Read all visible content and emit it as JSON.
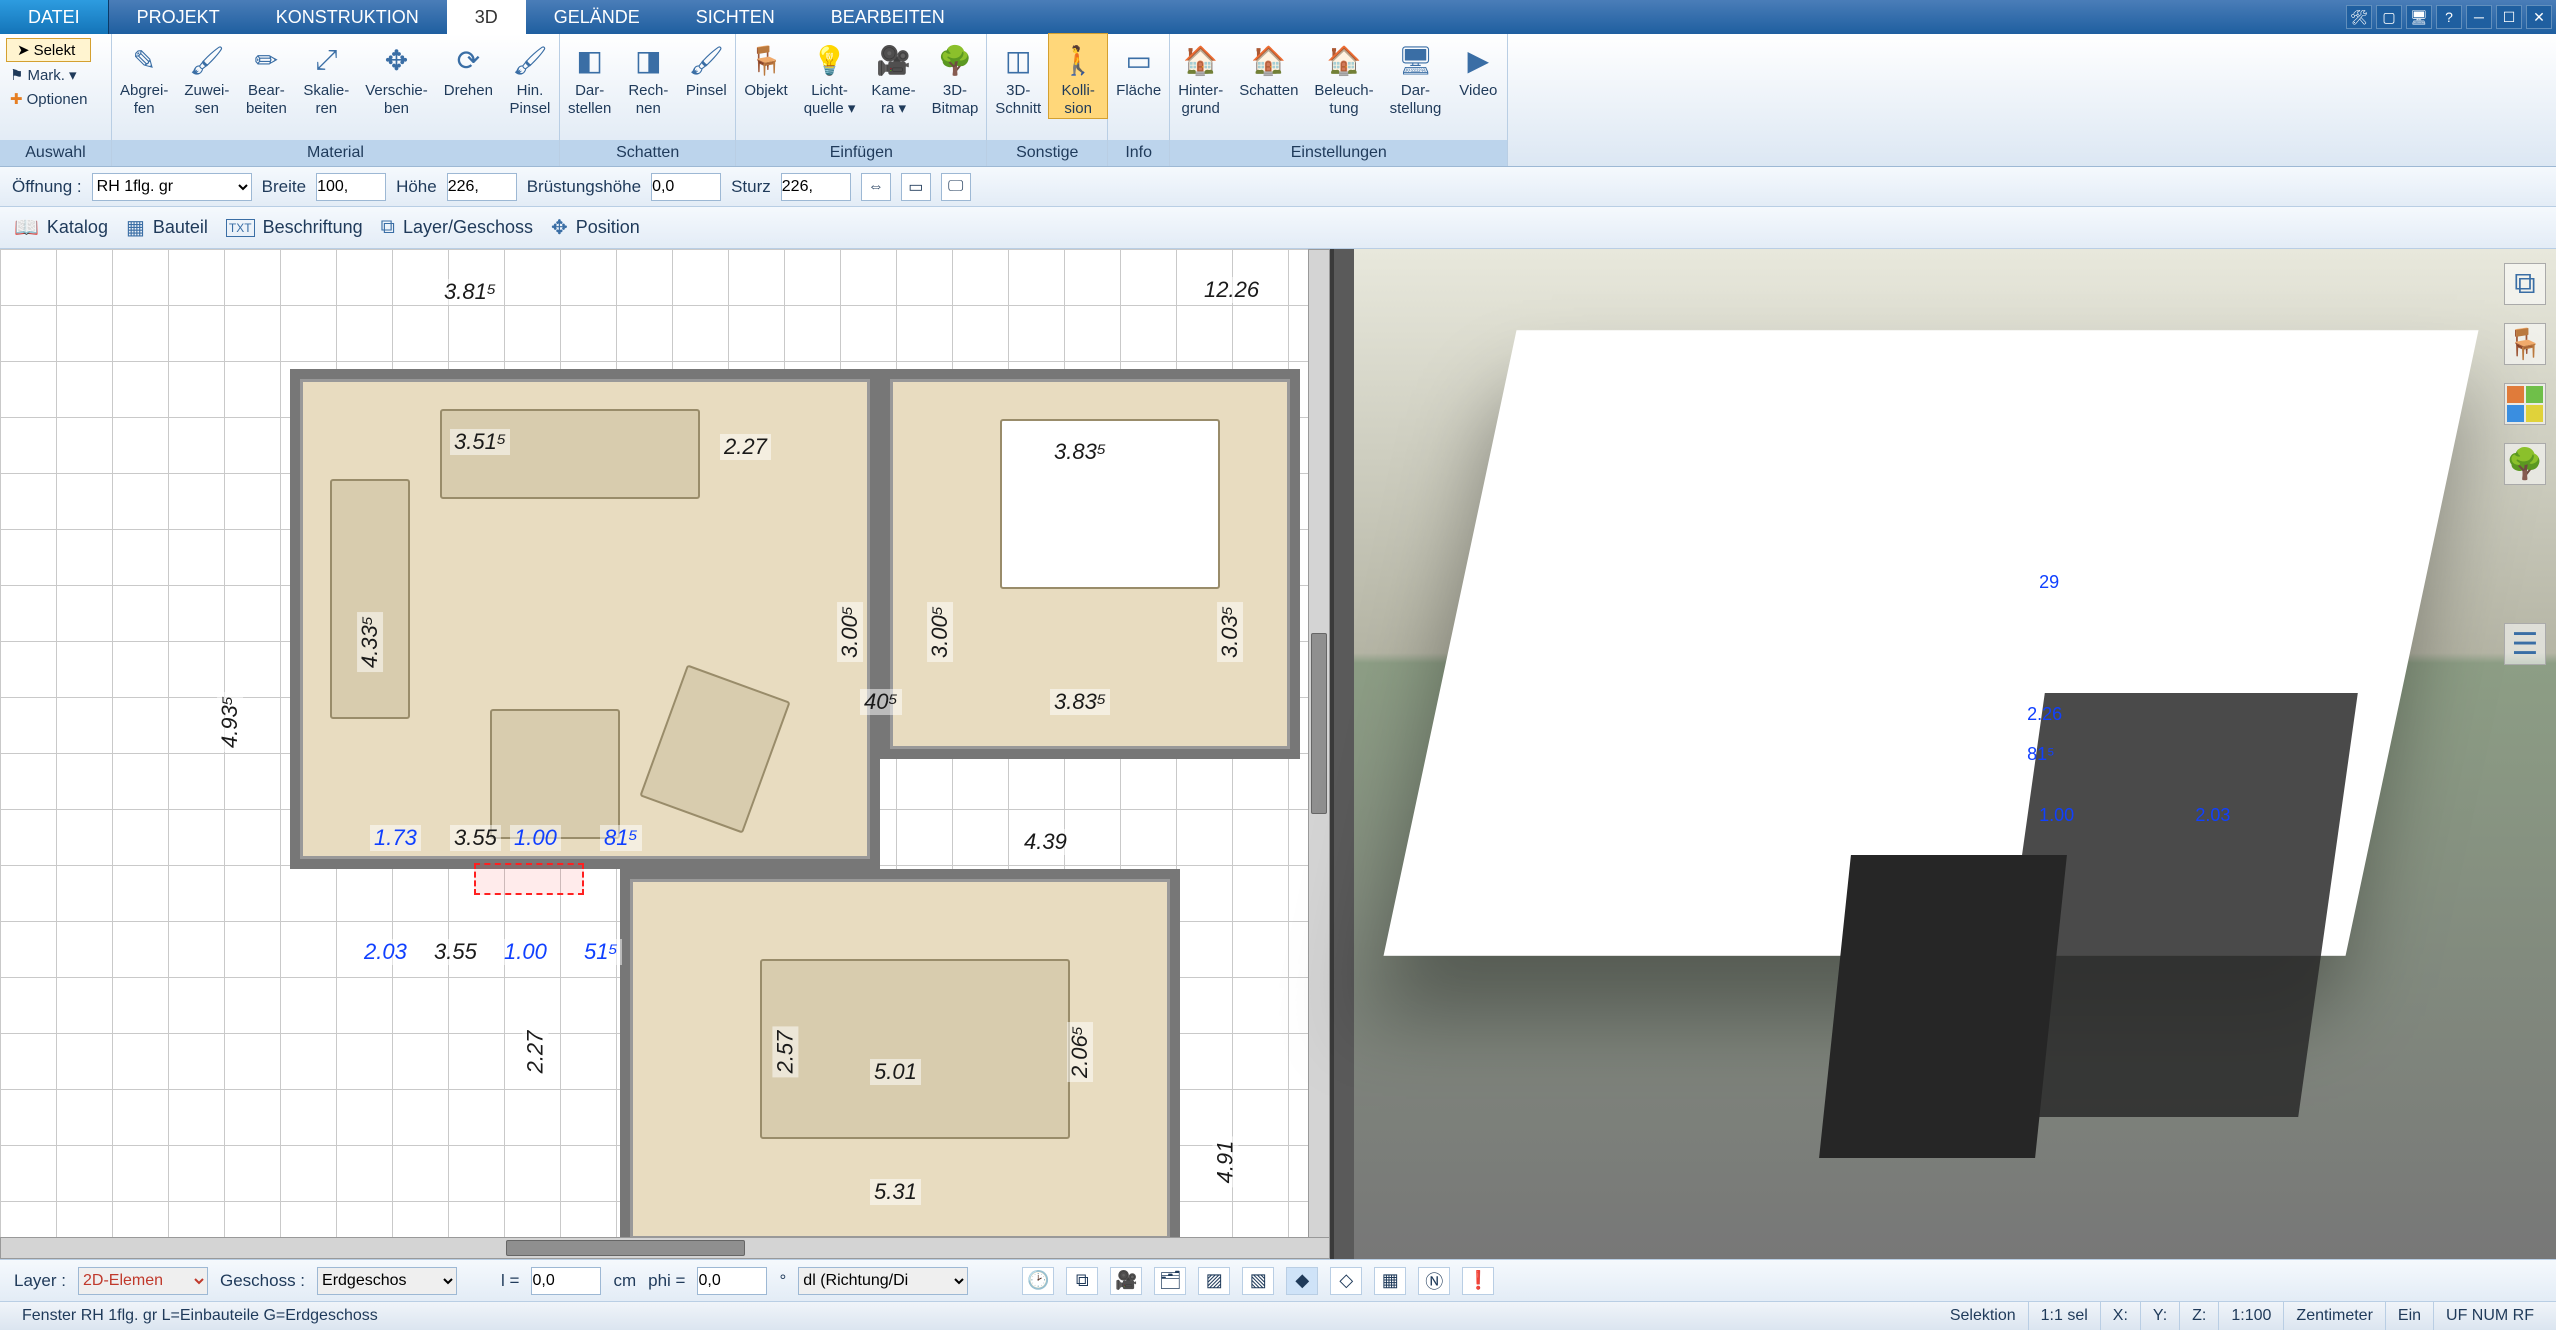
{
  "tabs": {
    "file": "DATEI",
    "items": [
      "PROJEKT",
      "KONSTRUKTION",
      "3D",
      "GELÄNDE",
      "SICHTEN",
      "BEARBEITEN"
    ],
    "active": "3D"
  },
  "selection": {
    "selekt": "Selekt",
    "mark": "Mark.",
    "optionen": "Optionen",
    "group": "Auswahl"
  },
  "ribbon_groups": [
    {
      "title": "Material",
      "buttons": [
        {
          "label": "Abgrei-\nfen"
        },
        {
          "label": "Zuwei-\nsen"
        },
        {
          "label": "Bear-\nbeiten"
        },
        {
          "label": "Skalie-\nren"
        },
        {
          "label": "Verschie-\nben"
        },
        {
          "label": "Drehen"
        },
        {
          "label": "Hin.\nPinsel"
        }
      ]
    },
    {
      "title": "Schatten",
      "buttons": [
        {
          "label": "Dar-\nstellen"
        },
        {
          "label": "Rech-\nnen"
        },
        {
          "label": "Pinsel"
        }
      ]
    },
    {
      "title": "Einfügen",
      "buttons": [
        {
          "label": "Objekt"
        },
        {
          "label": "Licht-\nquelle ▾"
        },
        {
          "label": "Kame-\nra ▾"
        },
        {
          "label": "3D-\nBitmap"
        }
      ]
    },
    {
      "title": "Sonstige",
      "buttons": [
        {
          "label": "3D-\nSchnitt"
        },
        {
          "label": "Kolli-\nsion",
          "active": true
        }
      ]
    },
    {
      "title": "Info",
      "buttons": [
        {
          "label": "Fläche"
        }
      ]
    },
    {
      "title": "Einstellungen",
      "buttons": [
        {
          "label": "Hinter-\ngrund"
        },
        {
          "label": "Schatten"
        },
        {
          "label": "Beleuch-\ntung"
        },
        {
          "label": "Dar-\nstellung"
        },
        {
          "label": "Video"
        }
      ]
    }
  ],
  "propbar": {
    "label": "Öffnung :",
    "type": "RH 1flg. gr",
    "breite_label": "Breite",
    "breite": "100,",
    "hoehe_label": "Höhe",
    "hoehe": "226,",
    "bruest_label": "Brüstungshöhe",
    "bruest": "0,0",
    "sturz_label": "Sturz",
    "sturz": "226,"
  },
  "toolbar2": [
    {
      "icon": "📖",
      "label": "Katalog"
    },
    {
      "icon": "▦",
      "label": "Bauteil"
    },
    {
      "icon": "TXT",
      "label": "Beschriftung"
    },
    {
      "icon": "⧉",
      "label": "Layer/Geschoss"
    },
    {
      "icon": "✥",
      "label": "Position"
    }
  ],
  "plan_dims": {
    "top1": "3.81⁵",
    "top2": "12.26",
    "left": "4.93⁵",
    "living": [
      "3.51⁵",
      "2.27",
      "4.33⁵",
      "3.00⁵",
      "3.00⁵",
      "40⁵",
      "3.03⁵"
    ],
    "bed": [
      "3.83⁵",
      "3.83⁵",
      "4.39"
    ],
    "bottom": [
      "1.73",
      "3.55",
      "1.00",
      "81⁵",
      "2.03",
      "3.55",
      "1.00",
      "51⁵"
    ],
    "dining": [
      "2.27",
      "2.57",
      "5.01",
      "2.06⁵",
      "5.31",
      "4.91"
    ]
  },
  "view3d_dims": {
    "a": "29",
    "b": "2.26",
    "c": "81⁵",
    "d": "1.00",
    "e": "2.03"
  },
  "bottom_bar": {
    "layer_label": "Layer :",
    "layer": "2D-Elemen",
    "geschoss_label": "Geschoss :",
    "geschoss": "Erdgeschos",
    "l_label": "l =",
    "l_val": "0,0",
    "l_unit": "cm",
    "phi_label": "phi =",
    "phi_val": "0,0",
    "phi_unit": "°",
    "mode": "dl (Richtung/Di"
  },
  "status": {
    "left": "Fenster RH 1flg. gr L=Einbauteile G=Erdgeschoss",
    "sel": "Selektion",
    "selcount": "1:1 sel",
    "x": "X:",
    "y": "Y:",
    "z": "Z:",
    "scale": "1:100",
    "unit": "Zentimeter",
    "ein": "Ein",
    "caps": "UF NUM RF"
  }
}
